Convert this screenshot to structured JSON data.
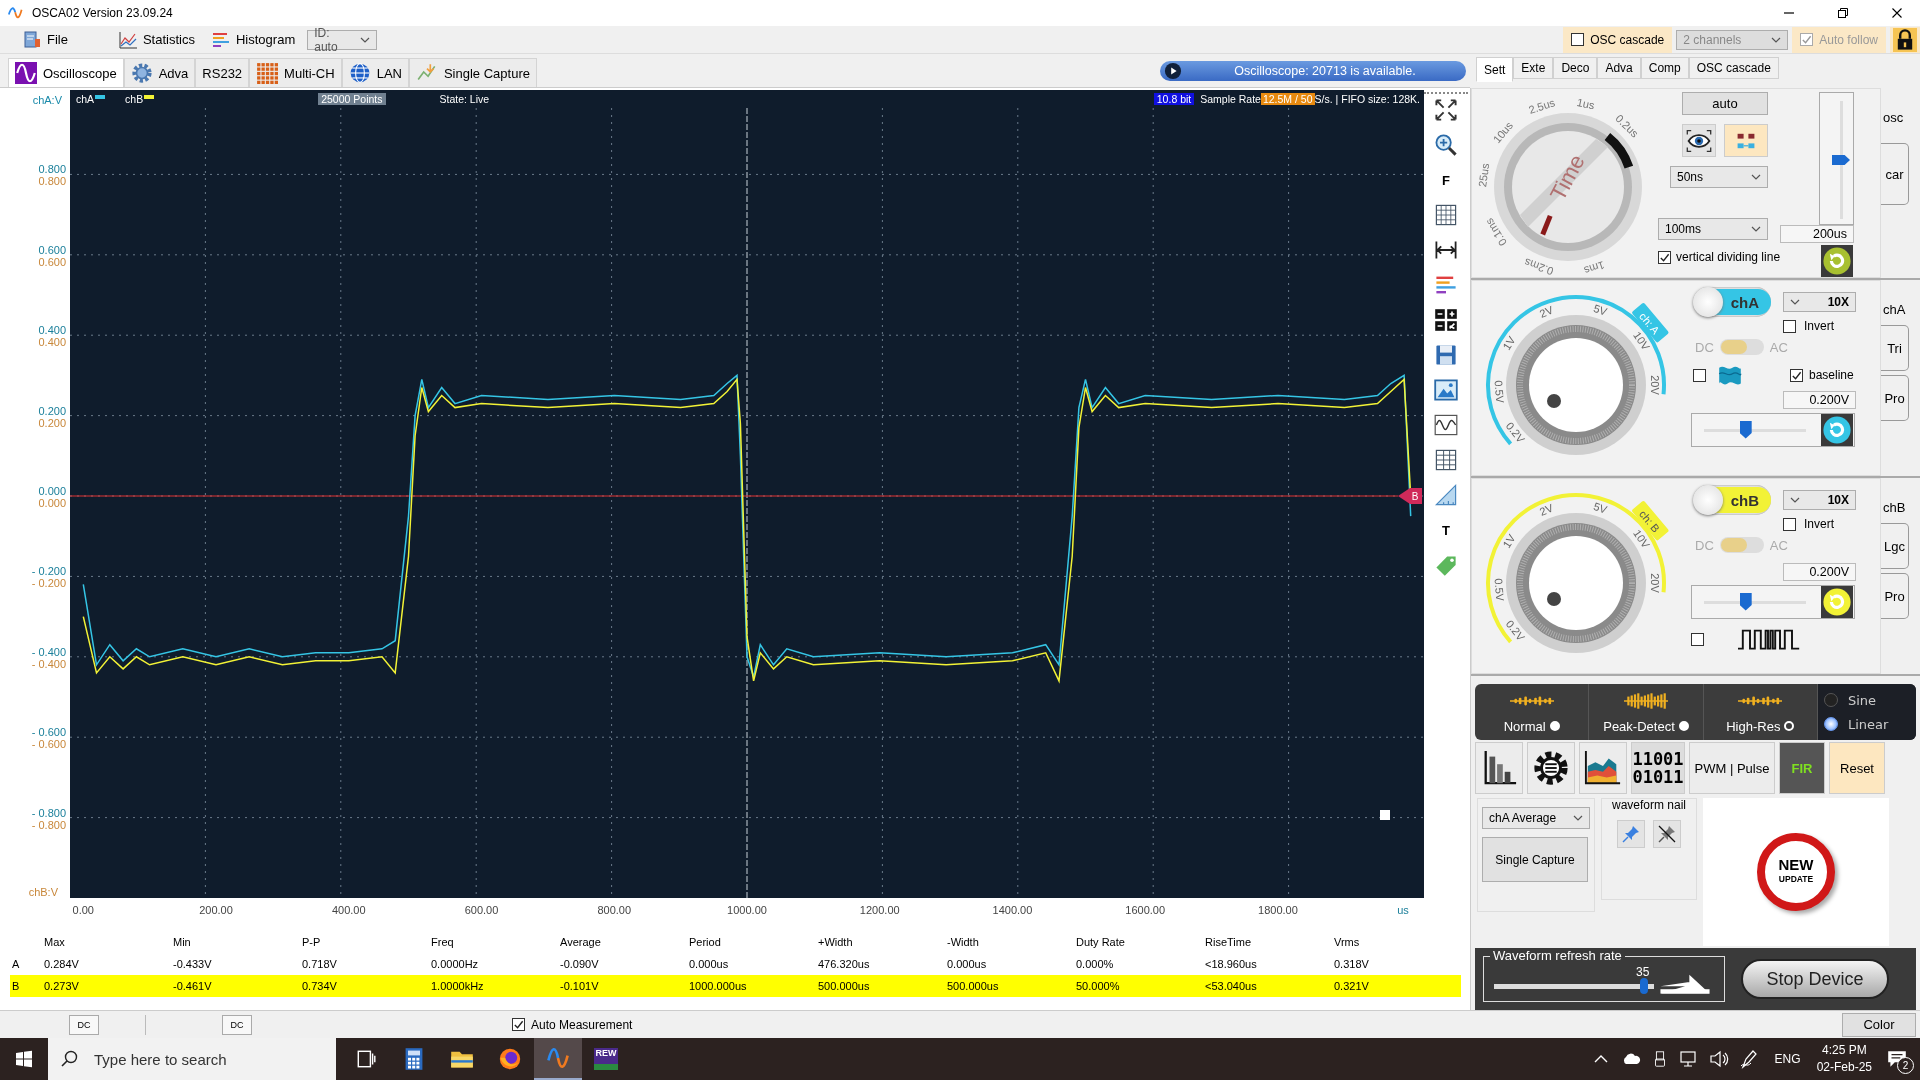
{
  "window": {
    "title": "OSCA02  Version 23.09.24"
  },
  "menu": [
    {
      "label": "File"
    },
    {
      "label": "Statistics"
    },
    {
      "label": "Histogram"
    }
  ],
  "id_select": {
    "value": "ID: auto"
  },
  "top_options": {
    "osc_cascade": {
      "label": "OSC cascade",
      "checked": false
    },
    "channels_select": {
      "value": "2 channels"
    },
    "auto_follow": {
      "label": "Auto follow",
      "checked": true,
      "disabled": true
    }
  },
  "main_tabs": [
    {
      "label": "Oscilloscope",
      "selected": true
    },
    {
      "label": "Adva",
      "selected": false
    },
    {
      "label": "RS232",
      "selected": false
    },
    {
      "label": "Multi-CH",
      "selected": false
    },
    {
      "label": "LAN",
      "selected": false
    },
    {
      "label": "Single Capture",
      "selected": false
    }
  ],
  "banner": {
    "text": "Oscilloscope: 20713 is available."
  },
  "plot": {
    "header": {
      "points": "25000 Points",
      "state": "State: Live",
      "bits": "10.8 bit",
      "sample_rate_label": "Sample Rate",
      "sample_rate": "12.5M / 50",
      "fifo": "S/s. | FIFO size: 128K."
    },
    "ylabel_b": "chB:V",
    "ytick_labels_b": [
      "0.800",
      "0.600",
      "0.400",
      "0.200",
      "0.000",
      "- 0.200",
      "- 0.400",
      "- 0.600",
      "- 0.800"
    ],
    "trigger_marker": "B",
    "chart_data": {
      "type": "line",
      "grid": true,
      "ref_lines": [
        {
          "axis": "x",
          "value": 1000,
          "color": "#c8d0d8"
        },
        {
          "axis": "y",
          "value": 0,
          "color": "#e03030"
        }
      ],
      "xlabel": "us",
      "ylabel": "chA:V",
      "xlim": [
        -20,
        2020
      ],
      "ylim": [
        -1.0,
        1.01
      ],
      "xticks": [
        {
          "value": 0,
          "label": "0.00"
        },
        {
          "value": 200,
          "label": "200.00"
        },
        {
          "value": 400,
          "label": "400.00"
        },
        {
          "value": 600,
          "label": "600.00"
        },
        {
          "value": 800,
          "label": "800.00"
        },
        {
          "value": 1000,
          "label": "1000.00"
        },
        {
          "value": 1200,
          "label": "1200.00"
        },
        {
          "value": 1400,
          "label": "1400.00"
        },
        {
          "value": 1600,
          "label": "1600.00"
        },
        {
          "value": 1800,
          "label": "1800.00"
        }
      ],
      "yticks": [
        {
          "value": 0.8,
          "label": "0.800"
        },
        {
          "value": 0.6,
          "label": "0.600"
        },
        {
          "value": 0.4,
          "label": "0.400"
        },
        {
          "value": 0.2,
          "label": "0.200"
        },
        {
          "value": 0,
          "label": "0.000"
        },
        {
          "value": -0.2,
          "label": "- 0.200"
        },
        {
          "value": -0.4,
          "label": "- 0.400"
        },
        {
          "value": -0.6,
          "label": "- 0.600"
        },
        {
          "value": -0.8,
          "label": "- 0.800"
        }
      ],
      "x": [
        0,
        20,
        40,
        60,
        80,
        100,
        150,
        200,
        250,
        300,
        350,
        400,
        450,
        470,
        490,
        500,
        510,
        520,
        540,
        560,
        600,
        700,
        800,
        900,
        950,
        970,
        985,
        990,
        1000,
        1010,
        1020,
        1040,
        1060,
        1100,
        1200,
        1300,
        1400,
        1450,
        1470,
        1490,
        1500,
        1510,
        1520,
        1540,
        1560,
        1600,
        1700,
        1800,
        1900,
        1950,
        1970,
        1990,
        2000
      ],
      "series": [
        {
          "name": "chA",
          "color": "#35c5e5",
          "values": [
            -0.22,
            -0.42,
            -0.37,
            -0.41,
            -0.38,
            -0.4,
            -0.38,
            -0.4,
            -0.38,
            -0.4,
            -0.39,
            -0.39,
            -0.38,
            -0.36,
            -0.05,
            0.2,
            0.29,
            0.22,
            0.27,
            0.23,
            0.25,
            0.24,
            0.25,
            0.24,
            0.25,
            0.28,
            0.3,
            0.1,
            -0.4,
            -0.45,
            -0.37,
            -0.42,
            -0.38,
            -0.4,
            -0.39,
            -0.4,
            -0.39,
            -0.37,
            -0.42,
            -0.05,
            0.22,
            0.29,
            0.22,
            0.27,
            0.23,
            0.25,
            0.24,
            0.25,
            0.24,
            0.25,
            0.28,
            0.3,
            -0.05
          ]
        },
        {
          "name": "chB",
          "color": "#f2f236",
          "values": [
            -0.3,
            -0.44,
            -0.4,
            -0.43,
            -0.4,
            -0.42,
            -0.4,
            -0.42,
            -0.4,
            -0.42,
            -0.41,
            -0.41,
            -0.4,
            -0.44,
            -0.15,
            0.15,
            0.27,
            0.21,
            0.25,
            0.22,
            0.23,
            0.22,
            0.23,
            0.22,
            0.23,
            0.26,
            0.29,
            0.18,
            -0.35,
            -0.46,
            -0.39,
            -0.43,
            -0.4,
            -0.42,
            -0.41,
            -0.42,
            -0.41,
            -0.39,
            -0.46,
            -0.15,
            0.17,
            0.27,
            0.21,
            0.25,
            0.22,
            0.23,
            0.22,
            0.23,
            0.22,
            0.23,
            0.26,
            0.29,
            0.0
          ]
        }
      ]
    }
  },
  "toolbar": [
    {
      "kind": "icon"
    },
    {
      "kind": "icon"
    },
    {
      "kind": "text",
      "label": "F"
    },
    {
      "kind": "icon"
    },
    {
      "kind": "icon"
    },
    {
      "kind": "icon"
    },
    {
      "kind": "icon"
    },
    {
      "kind": "icon"
    },
    {
      "kind": "icon"
    },
    {
      "kind": "icon"
    },
    {
      "kind": "icon"
    },
    {
      "kind": "icon"
    },
    {
      "kind": "text",
      "label": "T"
    },
    {
      "kind": "icon"
    }
  ],
  "measurements": {
    "columns": [
      "Max",
      "Min",
      "P-P",
      "Freq",
      "Average",
      "Period",
      "+Width",
      "-Width",
      "Duty Rate",
      "RiseTime",
      "Vrms"
    ],
    "rows": [
      {
        "channel": "A",
        "selected": false,
        "cells": [
          "0.284V",
          "-0.433V",
          "0.718V",
          "0.0000Hz",
          "-0.090V",
          "0.000us",
          "476.320us",
          "0.000us",
          "0.000%",
          "<18.960us",
          "0.318V"
        ]
      },
      {
        "channel": "B",
        "selected": true,
        "cells": [
          "0.273V",
          "-0.461V",
          "0.734V",
          "1.0000kHz",
          "-0.101V",
          "1000.000us",
          "500.000us",
          "500.000us",
          "50.000%",
          "<53.040us",
          "0.321V"
        ]
      }
    ]
  },
  "status_strip": {
    "coupling": [
      "DC",
      "DC"
    ],
    "auto_measurement": {
      "label": "Auto Measurement",
      "checked": true
    },
    "color_button": "Color"
  },
  "settings_tabs": [
    {
      "label": "Sett",
      "selected": true
    },
    {
      "label": "Exte",
      "selected": false
    },
    {
      "label": "Deco",
      "selected": false
    },
    {
      "label": "Adva",
      "selected": false
    },
    {
      "label": "Comp",
      "selected": false
    },
    {
      "label": "OSC cascade",
      "selected": false
    }
  ],
  "timebase": {
    "side_label": "osc",
    "side_tabs": [
      "car"
    ],
    "knob_title": "Time",
    "knob_labels": [
      "2.5us",
      "1us",
      "10us",
      "0.2us",
      "25us",
      "0.1ms",
      "0.2ms",
      "1ms"
    ],
    "auto_button": "auto",
    "timebase_select": "50ns",
    "memory_select": "100ms",
    "position": {
      "value": "200us",
      "level": 0.5
    },
    "dividing_line": {
      "label": "vertical dividing line",
      "checked": true
    }
  },
  "channels": [
    {
      "name": "chA",
      "tag": "ch: A",
      "color": "#35c5e5",
      "on": true,
      "probe": "10X",
      "invert": {
        "label": "Invert",
        "checked": false
      },
      "coupling": {
        "dc": "DC",
        "ac": "AC",
        "ac_selected": false
      },
      "side_label": "chA",
      "side_tabs": [
        "Tri",
        "Pro"
      ],
      "knob_labels": [
        "0.2V",
        "0.5V",
        "1V",
        "2V",
        "5V",
        "10V",
        "20V"
      ],
      "extra": {
        "kind": "wave",
        "checked": false
      },
      "baseline": {
        "label": "baseline",
        "checked": true
      },
      "offset": {
        "value": "0.200V",
        "level": 0.35
      }
    },
    {
      "name": "chB",
      "tag": "ch: B",
      "color": "#f2f236",
      "on": true,
      "probe": "10X",
      "invert": {
        "label": "Invert",
        "checked": false
      },
      "coupling": {
        "dc": "DC",
        "ac": "AC",
        "ac_selected": false
      },
      "side_label": "chB",
      "side_tabs": [
        "Lgc",
        "Pro"
      ],
      "knob_labels": [
        "0.2V",
        "0.5V",
        "1V",
        "2V",
        "5V",
        "10V",
        "20V"
      ],
      "extra": {
        "kind": "pulse",
        "checked": false
      },
      "offset": {
        "value": "0.200V",
        "level": 0.35
      }
    }
  ],
  "acquisition": {
    "modes": [
      {
        "label": "Normal",
        "on": true
      },
      {
        "label": "Peak-Detect",
        "on": true
      },
      {
        "label": "High-Res",
        "on": false
      }
    ],
    "interpolation": [
      {
        "label": "Sine",
        "selected": false
      },
      {
        "label": "Linear",
        "selected": true
      }
    ]
  },
  "tools": [
    {
      "kind": "icon"
    },
    {
      "kind": "icon"
    },
    {
      "kind": "icon"
    },
    {
      "kind": "binary",
      "lines": [
        "11001",
        "01011"
      ]
    },
    {
      "kind": "text",
      "label": "PWM | Pulse"
    },
    {
      "kind": "fir",
      "label": "FIR"
    },
    {
      "kind": "reset",
      "label": "Reset"
    }
  ],
  "average_select": {
    "value": "chA Average"
  },
  "single_capture": "Single Capture",
  "waveform_nail": {
    "title": "waveform nail"
  },
  "update_badge": {
    "line1": "NEW",
    "line2": "UPDATE"
  },
  "refresh_rate": {
    "title": "Waveform refresh rate",
    "value": "35",
    "level": 0.94
  },
  "stop_button": "Stop Device",
  "taskbar": {
    "search_placeholder": "Type here to search",
    "apps": [
      {
        "active": false
      },
      {
        "active": false
      },
      {
        "active": false
      },
      {
        "active": true
      },
      {
        "label": "REW",
        "active": false
      }
    ],
    "language": "ENG",
    "time": "4:25 PM",
    "date": "02-Feb-25",
    "notifications": "2"
  }
}
